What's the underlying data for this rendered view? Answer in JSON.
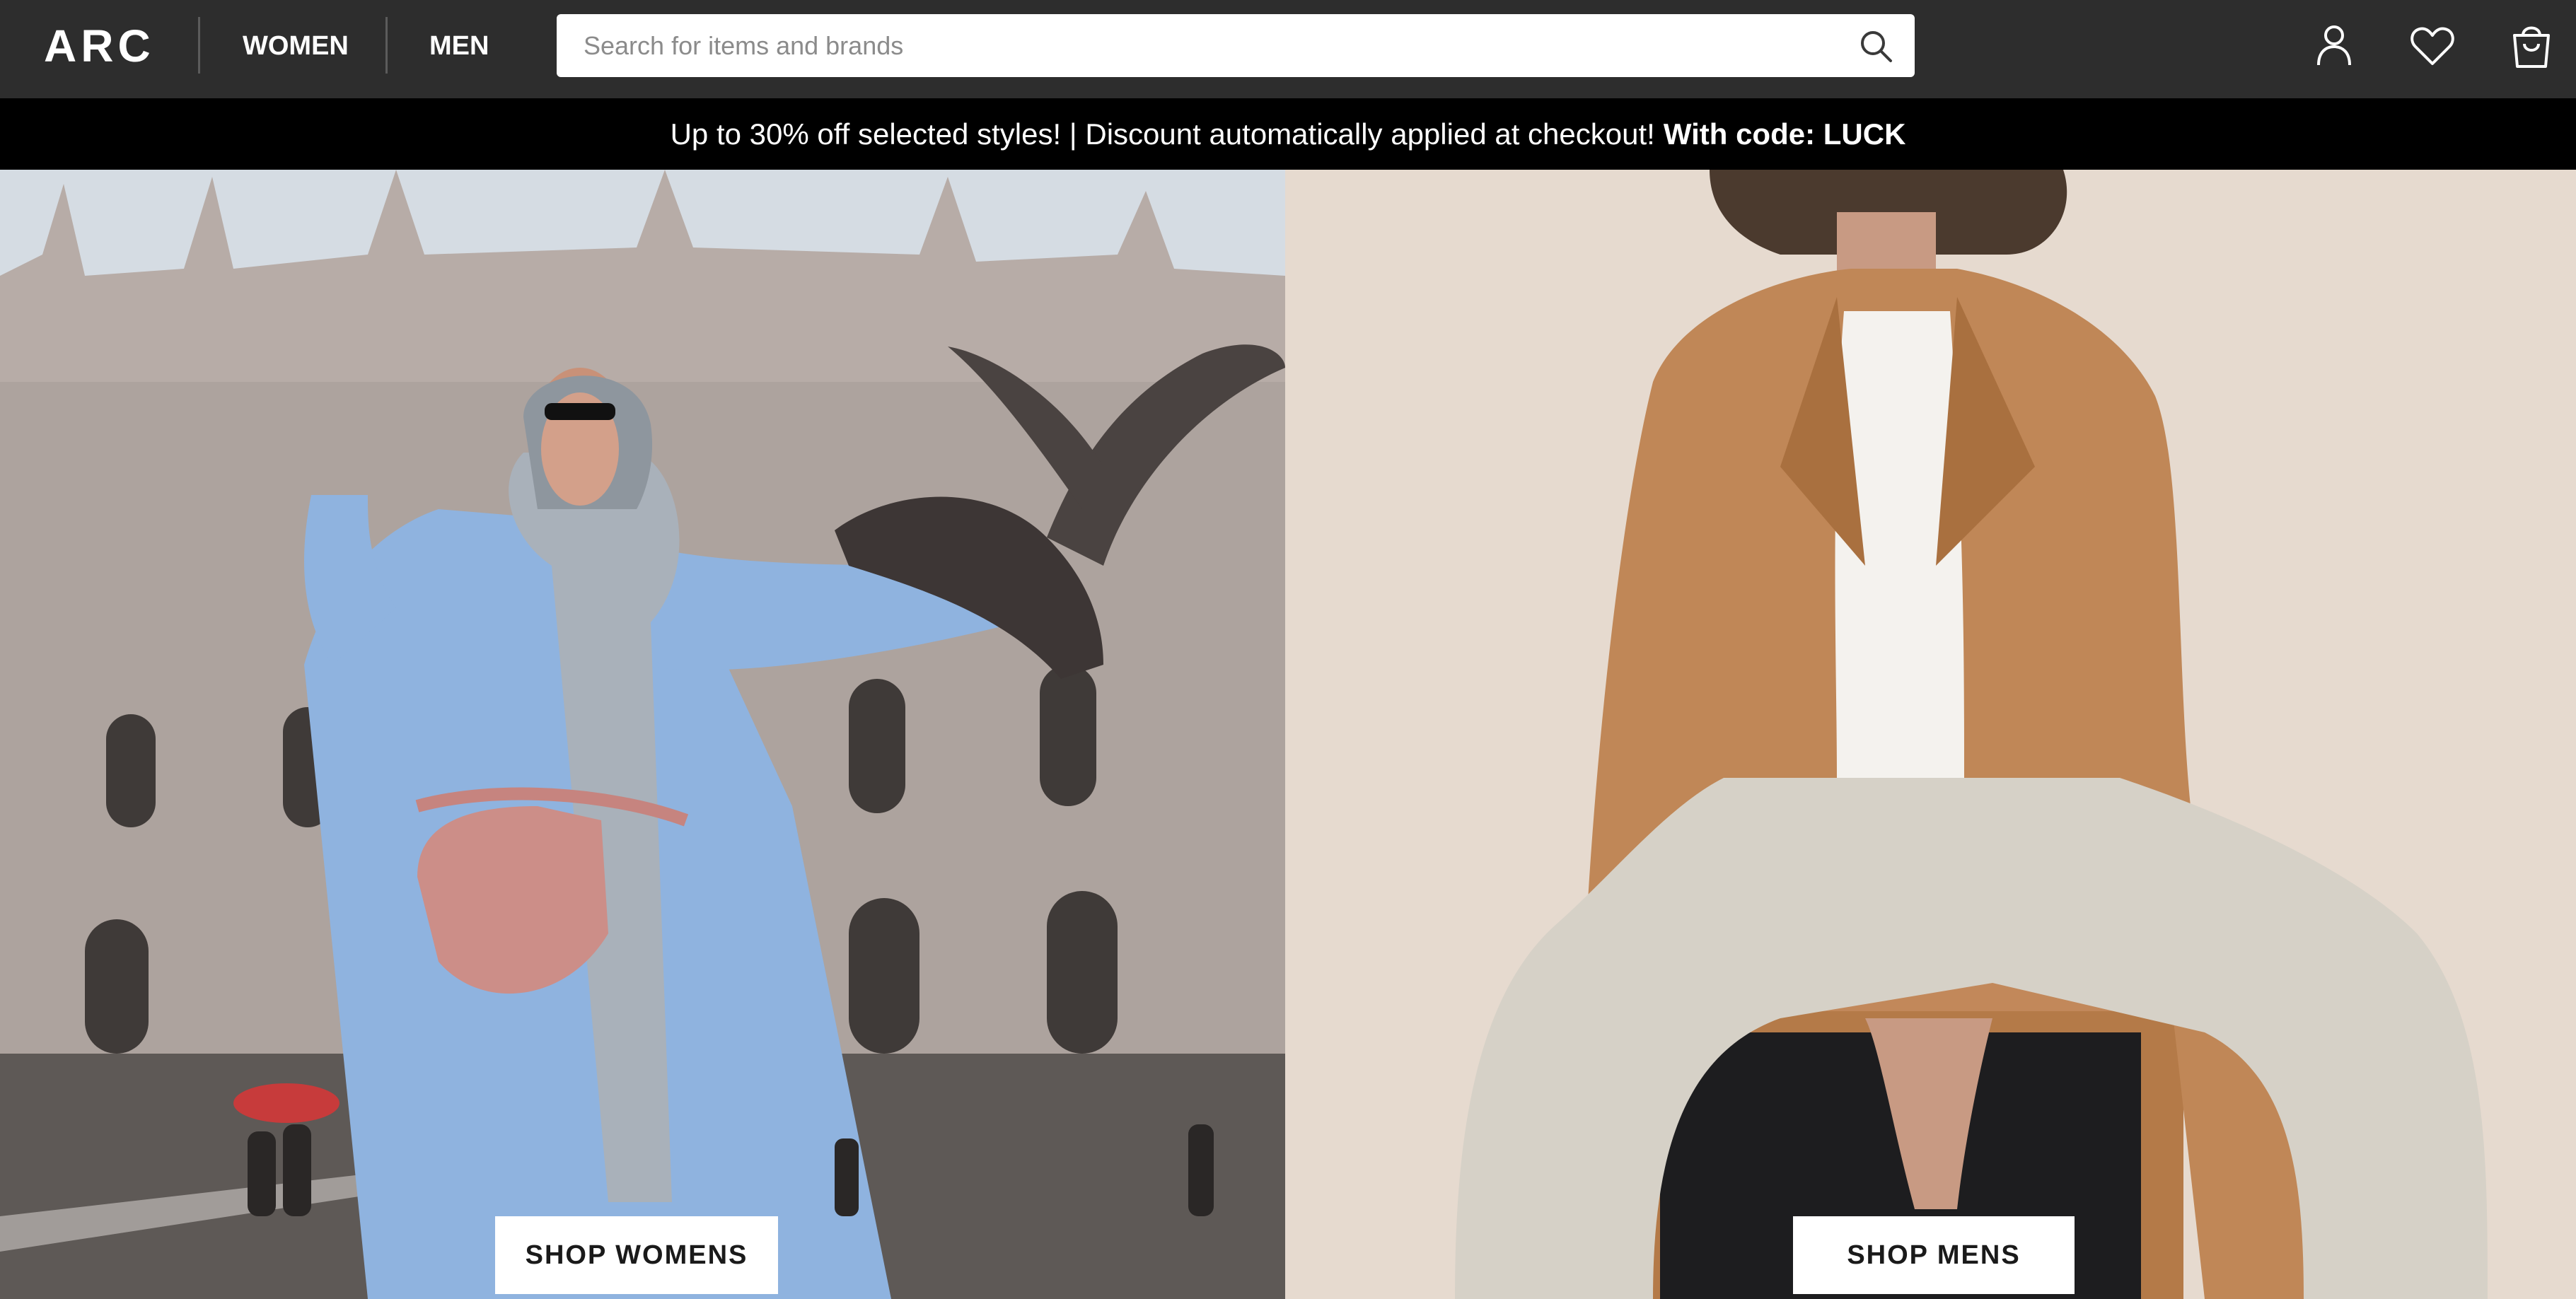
{
  "header": {
    "logo": "ARC",
    "nav": {
      "women": "WOMEN",
      "men": "MEN"
    },
    "search": {
      "placeholder": "Search for items and brands",
      "value": ""
    },
    "icons": [
      "account-icon",
      "heart-icon",
      "shopping-bag-icon",
      "search-icon"
    ],
    "background_color": "#2d2d2d"
  },
  "promo": {
    "text": "Up to 30% off selected styles! | Discount automatically applied at checkout!",
    "code_text": "With code: LUCK",
    "background_color": "#000000"
  },
  "hero": {
    "women": {
      "button_label": "SHOP WOMENS"
    },
    "men": {
      "button_label": "SHOP MENS"
    }
  }
}
